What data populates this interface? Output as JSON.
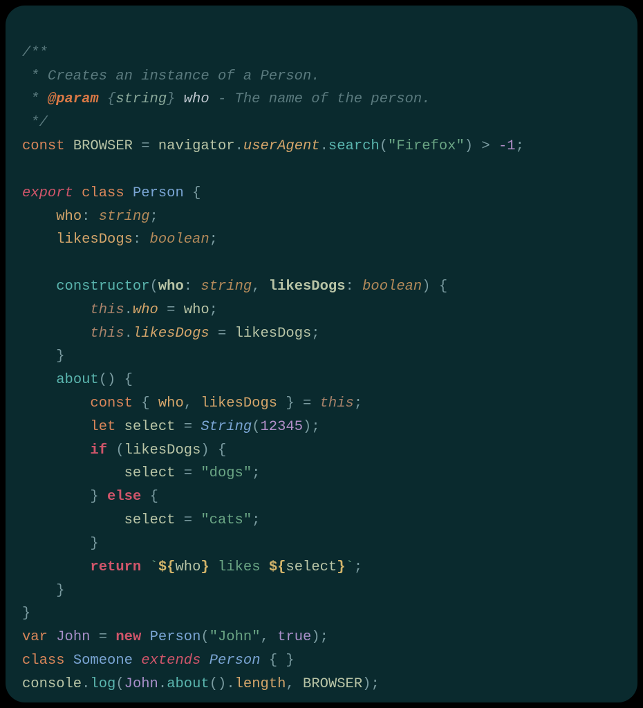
{
  "colors": {
    "background": "#0a2a2e",
    "comment": "#5a7a7e",
    "keyword_red": "#d0556a",
    "keyword_orange": "#d9865a",
    "class": "#7aa5d4",
    "identifier": "#b8c4a6",
    "property": "#d4a56a",
    "type": "#b48a5a",
    "string": "#6aa584",
    "number": "#b38fc9",
    "purple": "#a88fc9",
    "teal": "#5ab5ae",
    "punctuation": "#7a9ba0"
  },
  "doc": {
    "open": "/**",
    "line1_prefix": " * ",
    "line1_text": "Creates an instance of a Person.",
    "line2_prefix": " * ",
    "param_tag": "@param",
    "param_brace_open": " {",
    "param_type": "string",
    "param_brace_close": "} ",
    "param_name": "who",
    "param_desc": " - The name of the person.",
    "close": " */"
  },
  "l5": {
    "const": "const",
    "sp1": " ",
    "browser": "BROWSER",
    "eq": " = ",
    "nav": "navigator",
    "dot1": ".",
    "ua": "userAgent",
    "dot2": ".",
    "search": "search",
    "po": "(",
    "str": "\"Firefox\"",
    "pc": ")",
    "gt": " > ",
    "neg1": "-1",
    "semi": ";"
  },
  "l7": {
    "export": "export",
    "sp1": " ",
    "class": "class",
    "sp2": " ",
    "name": "Person",
    "brace": " {"
  },
  "l8": {
    "indent": "    ",
    "who": "who",
    "colon": ": ",
    "type": "string",
    "semi": ";"
  },
  "l9": {
    "indent": "    ",
    "likes": "likesDogs",
    "colon": ": ",
    "type": "boolean",
    "semi": ";"
  },
  "l11": {
    "indent": "    ",
    "ctor": "constructor",
    "po": "(",
    "p1": "who",
    "c1": ": ",
    "t1": "string",
    "comma": ", ",
    "p2": "likesDogs",
    "c2": ": ",
    "t2": "boolean",
    "pc": ")",
    "brace": " {"
  },
  "l12": {
    "indent": "        ",
    "this": "this",
    "dot": ".",
    "prop": "who",
    "eq": " = ",
    "val": "who",
    "semi": ";"
  },
  "l13": {
    "indent": "        ",
    "this": "this",
    "dot": ".",
    "prop": "likesDogs",
    "eq": " = ",
    "val": "likesDogs",
    "semi": ";"
  },
  "l14": {
    "indent": "    ",
    "brace": "}"
  },
  "l15": {
    "indent": "    ",
    "name": "about",
    "parens": "()",
    "brace": " {"
  },
  "l16": {
    "indent": "        ",
    "const": "const",
    "sp": " ",
    "bo": "{ ",
    "v1": "who",
    "comma": ", ",
    "v2": "likesDogs",
    "bc": " }",
    "eq": " = ",
    "this": "this",
    "semi": ";"
  },
  "l17": {
    "indent": "        ",
    "let": "let",
    "sp": " ",
    "sel": "select",
    "eq": " = ",
    "string": "String",
    "po": "(",
    "num": "12345",
    "pc": ")",
    "semi": ";"
  },
  "l18": {
    "indent": "        ",
    "if": "if",
    "sp": " ",
    "po": "(",
    "cond": "likesDogs",
    "pc": ")",
    "brace": " {"
  },
  "l19": {
    "indent": "            ",
    "sel": "select",
    "eq": " = ",
    "str": "\"dogs\"",
    "semi": ";"
  },
  "l20": {
    "indent": "        ",
    "close": "}",
    "sp": " ",
    "else": "else",
    "brace": " {"
  },
  "l21": {
    "indent": "            ",
    "sel": "select",
    "eq": " = ",
    "str": "\"cats\"",
    "semi": ";"
  },
  "l22": {
    "indent": "        ",
    "brace": "}"
  },
  "l23": {
    "indent": "        ",
    "return": "return",
    "sp": " ",
    "bt1": "`",
    "d1": "${",
    "v1": "who",
    "d1c": "}",
    "txt": " likes ",
    "d2": "${",
    "v2": "select",
    "d2c": "}",
    "bt2": "`",
    "semi": ";"
  },
  "l24": {
    "indent": "    ",
    "brace": "}"
  },
  "l25": {
    "brace": "}"
  },
  "l26": {
    "var": "var",
    "sp": " ",
    "john": "John",
    "eq": " = ",
    "new": "new",
    "sp2": " ",
    "cls": "Person",
    "po": "(",
    "str": "\"John\"",
    "comma": ", ",
    "true": "true",
    "pc": ")",
    "semi": ";"
  },
  "l27": {
    "class": "class",
    "sp": " ",
    "name": "Someone",
    "sp2": " ",
    "extends": "extends",
    "sp3": " ",
    "parent": "Person",
    "braces": " { }"
  },
  "l28": {
    "console": "console",
    "dot1": ".",
    "log": "log",
    "po": "(",
    "john": "John",
    "dot2": ".",
    "about": "about",
    "parens": "()",
    "dot3": ".",
    "length": "length",
    "comma": ", ",
    "browser": "BROWSER",
    "pc": ")",
    "semi": ";"
  }
}
